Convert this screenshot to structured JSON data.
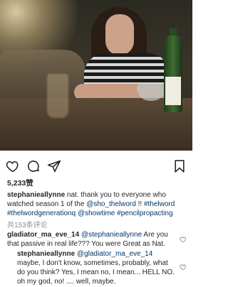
{
  "post": {
    "likes_text": "5,233赞",
    "caption": {
      "username": "stephanieallynne",
      "text_1": " nat. thank you to everyone who watched season 1 of the ",
      "mention_1": "@sho_thelword",
      "text_2": " !! ",
      "hashtag_1": "#thelword",
      "text_3": " ",
      "hashtag_2": "#thelwordgenerationq",
      "text_4": " ",
      "mention_2": "@showtime",
      "text_5": " ",
      "hashtag_3": "#pencilpropacting"
    },
    "view_comments": "共153条评论"
  },
  "comments": [
    {
      "username": "gladiator_ma_eve_14",
      "mention": "@stephanieallynne",
      "text": " Are you that passive in real life??? You were Great as Nat."
    },
    {
      "username": "stephanieallynne",
      "mention": "@gladiator_ma_eve_14",
      "text": " maybe, I don't know, sometimes, probably, what do you think? Yes, I mean no, I mean... HELL NO. oh my god, no! .... well, maybe."
    }
  ],
  "icons": {
    "like": "heart-icon",
    "comment": "comment-bubble-icon",
    "share": "send-icon",
    "save": "bookmark-icon"
  }
}
